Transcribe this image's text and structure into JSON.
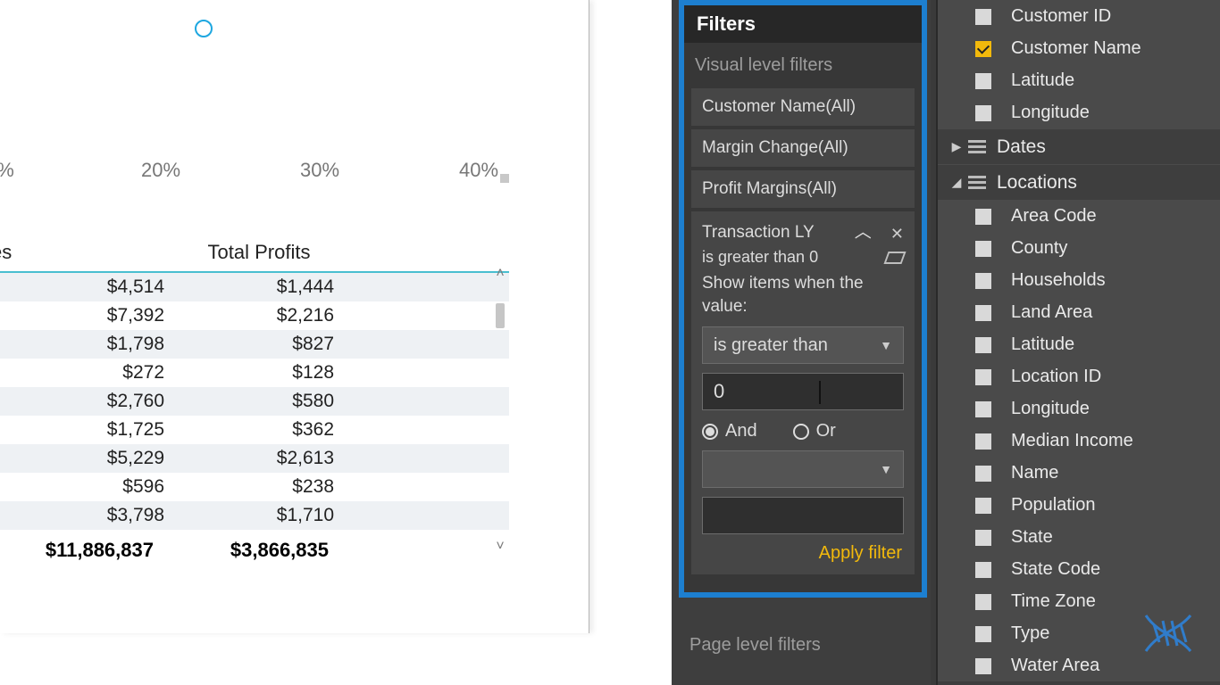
{
  "scatter": {
    "xlabels": [
      "%",
      "20%",
      "30%",
      "40%"
    ]
  },
  "table": {
    "headers": {
      "c1": "es",
      "c2": "",
      "c3": "Total Profits"
    },
    "rows": [
      {
        "c2": "$4,514",
        "c3": "$1,444"
      },
      {
        "c2": "$7,392",
        "c3": "$2,216"
      },
      {
        "c2": "$1,798",
        "c3": "$827"
      },
      {
        "c2": "$272",
        "c3": "$128"
      },
      {
        "c2": "$2,760",
        "c3": "$580"
      },
      {
        "c2": "$1,725",
        "c3": "$362"
      },
      {
        "c2": "$5,229",
        "c3": "$2,613"
      },
      {
        "c2": "$596",
        "c3": "$238"
      },
      {
        "c2": "$3,798",
        "c3": "$1,710"
      }
    ],
    "totals": {
      "c2": "$11,886,837",
      "c3": "$3,866,835"
    }
  },
  "filters": {
    "title": "Filters",
    "section_visual": "Visual level filters",
    "cards": [
      {
        "label": "Customer Name(All)"
      },
      {
        "label": "Margin Change(All)"
      },
      {
        "label": "Profit Margins(All)"
      }
    ],
    "active": {
      "label": "Transaction LY",
      "condition": "is greater than 0",
      "prompt": "Show items when the value:",
      "op_selected": "is greater than",
      "value1": "0",
      "logic_and": "And",
      "logic_or": "Or",
      "op2_selected": "",
      "value2": "",
      "apply": "Apply filter"
    },
    "section_page": "Page level filters"
  },
  "fields": {
    "top": [
      {
        "name": "Customer ID",
        "checked": false
      },
      {
        "name": "Customer Name",
        "checked": true
      },
      {
        "name": "Latitude",
        "checked": false
      },
      {
        "name": "Longitude",
        "checked": false
      }
    ],
    "tables": [
      {
        "name": "Dates",
        "expanded": false
      },
      {
        "name": "Locations",
        "expanded": true,
        "fields": [
          "Area Code",
          "County",
          "Households",
          "Land Area",
          "Latitude",
          "Location ID",
          "Longitude",
          "Median Income",
          "Name",
          "Population",
          "State",
          "State Code",
          "Time Zone",
          "Type",
          "Water Area"
        ]
      }
    ]
  }
}
